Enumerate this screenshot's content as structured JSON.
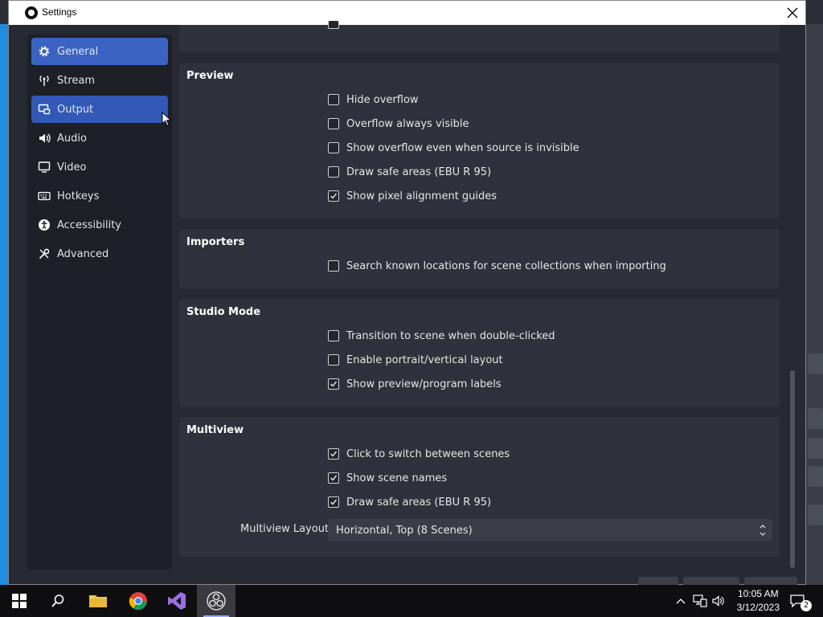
{
  "window": {
    "title": "Settings"
  },
  "sidebar": {
    "items": [
      {
        "label": "General",
        "icon": "gear-icon"
      },
      {
        "label": "Stream",
        "icon": "antenna-icon"
      },
      {
        "label": "Output",
        "icon": "output-icon"
      },
      {
        "label": "Audio",
        "icon": "speaker-icon"
      },
      {
        "label": "Video",
        "icon": "monitor-icon"
      },
      {
        "label": "Hotkeys",
        "icon": "keyboard-icon"
      },
      {
        "label": "Accessibility",
        "icon": "accessibility-icon"
      },
      {
        "label": "Advanced",
        "icon": "tools-icon"
      }
    ],
    "active": "General",
    "hovered": "Output"
  },
  "preview": {
    "title": "Preview",
    "options": [
      {
        "label": "Hide overflow",
        "checked": false
      },
      {
        "label": "Overflow always visible",
        "checked": false
      },
      {
        "label": "Show overflow even when source is invisible",
        "checked": false
      },
      {
        "label": "Draw safe areas (EBU R 95)",
        "checked": false
      },
      {
        "label": "Show pixel alignment guides",
        "checked": true
      }
    ]
  },
  "importers": {
    "title": "Importers",
    "options": [
      {
        "label": "Search known locations for scene collections when importing",
        "checked": false
      }
    ]
  },
  "studio_mode": {
    "title": "Studio Mode",
    "options": [
      {
        "label": "Transition to scene when double-clicked",
        "checked": false
      },
      {
        "label": "Enable portrait/vertical layout",
        "checked": false
      },
      {
        "label": "Show preview/program labels",
        "checked": true
      }
    ]
  },
  "multiview": {
    "title": "Multiview",
    "options": [
      {
        "label": "Click to switch between scenes",
        "checked": true
      },
      {
        "label": "Show scene names",
        "checked": true
      },
      {
        "label": "Draw safe areas (EBU R 95)",
        "checked": true
      }
    ],
    "layout_label": "Multiview Layout",
    "layout_value": "Horizontal, Top (8 Scenes)"
  },
  "taskbar": {
    "time": "10:05 AM",
    "date": "3/12/2023",
    "notification_count": "2"
  },
  "colors": {
    "accent": "#3b63c4",
    "panel": "#2f323c",
    "background": "#272a33"
  }
}
